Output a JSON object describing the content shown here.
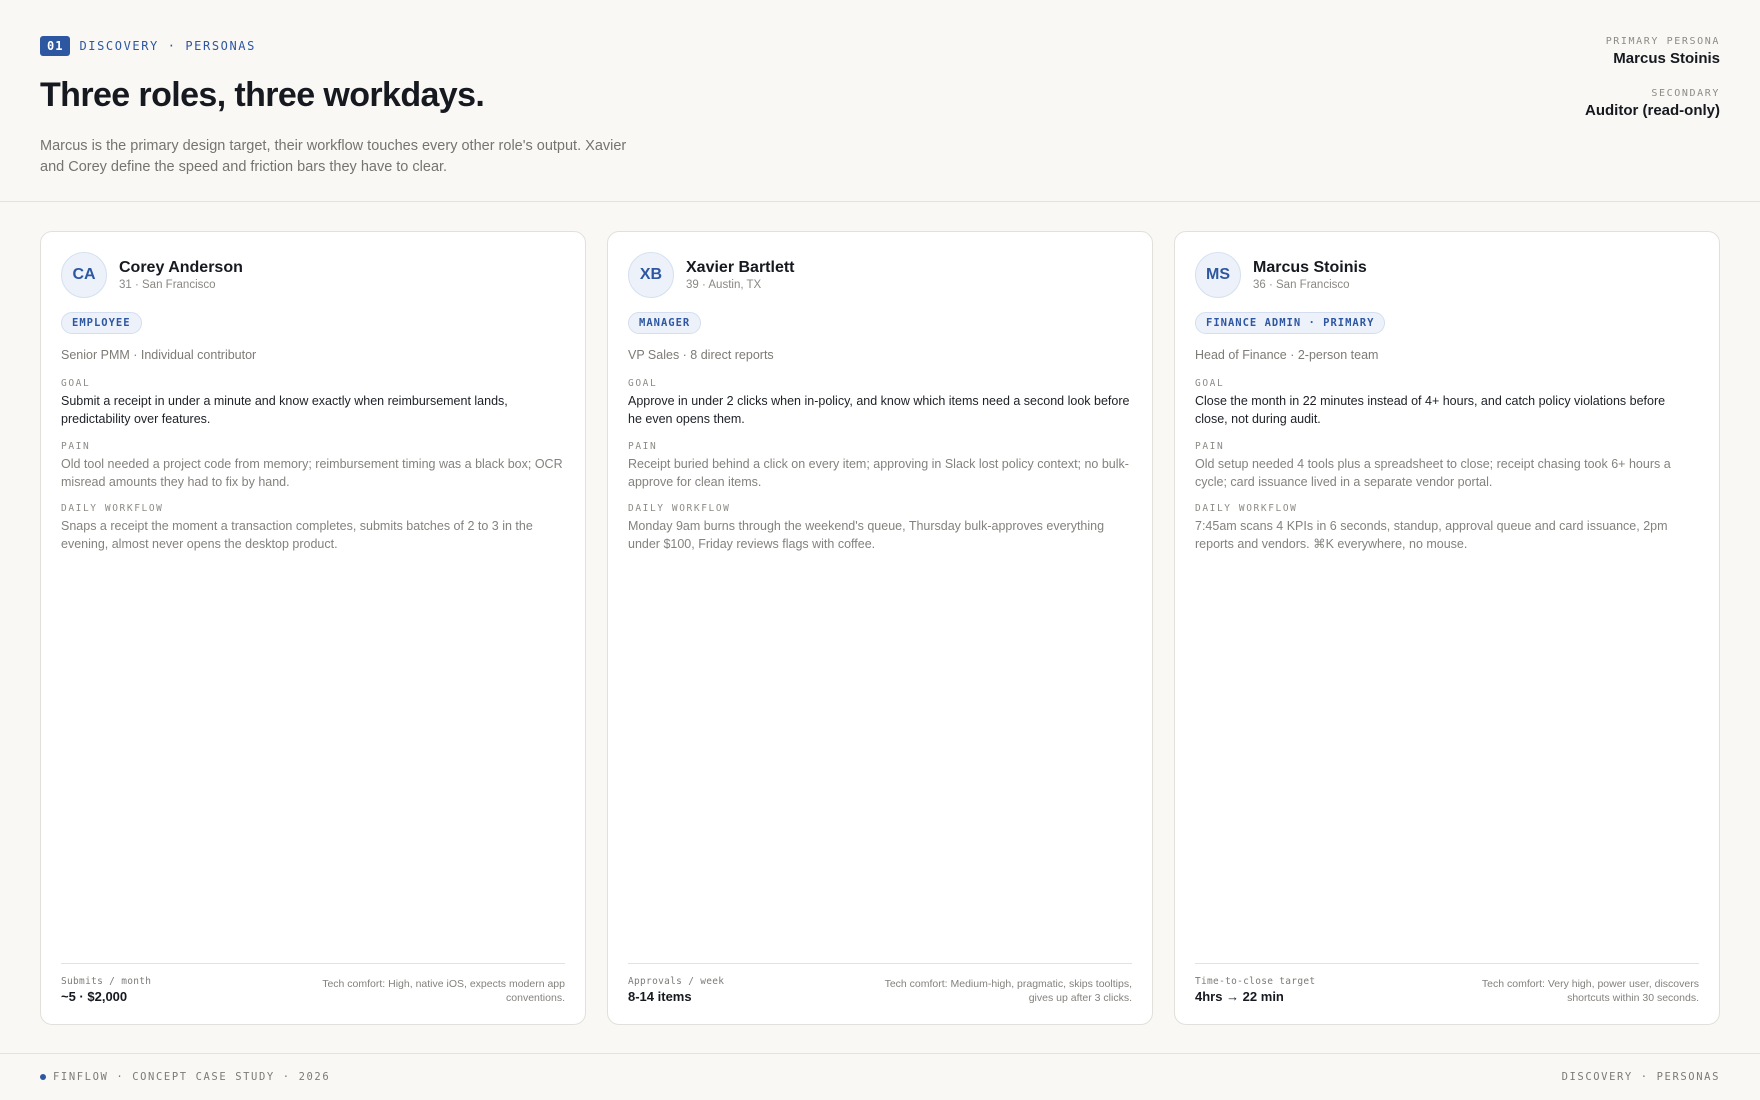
{
  "header": {
    "step": "01",
    "eyebrow": "DISCOVERY · PERSONAS",
    "title": "Three roles, three workdays.",
    "subtitle": "Marcus is the primary design target, their workflow touches every other role's output. Xavier and Corey define the speed and friction bars they have to clear.",
    "primary_label": "PRIMARY PERSONA",
    "primary_value": "Marcus Stoinis",
    "secondary_label": "SECONDARY",
    "secondary_value": "Auditor (read-only)"
  },
  "section_labels": {
    "goal": "GOAL",
    "pain": "PAIN",
    "workflow": "DAILY WORKFLOW"
  },
  "personas": [
    {
      "initials": "CA",
      "name": "Corey Anderson",
      "meta": "31 · San Francisco",
      "badge": "EMPLOYEE",
      "role": "Senior PMM · Individual contributor",
      "goal": "Submit a receipt in under a minute and know exactly when reimbursement lands, predictability over features.",
      "pain": "Old tool needed a project code from memory; reimbursement timing was a black box; OCR misread amounts they had to fix by hand.",
      "workflow": "Snaps a receipt the moment a transaction completes, submits batches of 2 to 3 in the evening, almost never opens the desktop product.",
      "metric_label": "Submits / month",
      "metric_value": "~5 · $2,000",
      "tech": "Tech comfort: High, native iOS, expects modern app conventions."
    },
    {
      "initials": "XB",
      "name": "Xavier Bartlett",
      "meta": "39 · Austin, TX",
      "badge": "MANAGER",
      "role": "VP Sales · 8 direct reports",
      "goal": "Approve in under 2 clicks when in-policy, and know which items need a second look before he even opens them.",
      "pain": "Receipt buried behind a click on every item; approving in Slack lost policy context; no bulk-approve for clean items.",
      "workflow": "Monday 9am burns through the weekend's queue, Thursday bulk-approves everything under $100, Friday reviews flags with coffee.",
      "metric_label": "Approvals / week",
      "metric_value": "8-14 items",
      "tech": "Tech comfort: Medium-high, pragmatic, skips tooltips, gives up after 3 clicks."
    },
    {
      "initials": "MS",
      "name": "Marcus Stoinis",
      "meta": "36 · San Francisco",
      "badge": "FINANCE ADMIN · PRIMARY",
      "role": "Head of Finance · 2-person team",
      "goal": "Close the month in 22 minutes instead of 4+ hours, and catch policy violations before close, not during audit.",
      "pain": "Old setup needed 4 tools plus a spreadsheet to close; receipt chasing took 6+ hours a cycle; card issuance lived in a separate vendor portal.",
      "workflow": "7:45am scans 4 KPIs in 6 seconds, standup, approval queue and card issuance, 2pm reports and vendors. ⌘K everywhere, no mouse.",
      "metric_label": "Time-to-close target",
      "metric_value": "4hrs → 22 min",
      "tech": "Tech comfort: Very high, power user, discovers shortcuts within 30 seconds."
    }
  ],
  "footer": {
    "left": "FINFLOW · CONCEPT CASE STUDY · 2026",
    "right": "DISCOVERY · PERSONAS"
  },
  "colors": {
    "accent": "#2e57a1",
    "background": "#f9f8f5",
    "card": "#ffffff"
  }
}
